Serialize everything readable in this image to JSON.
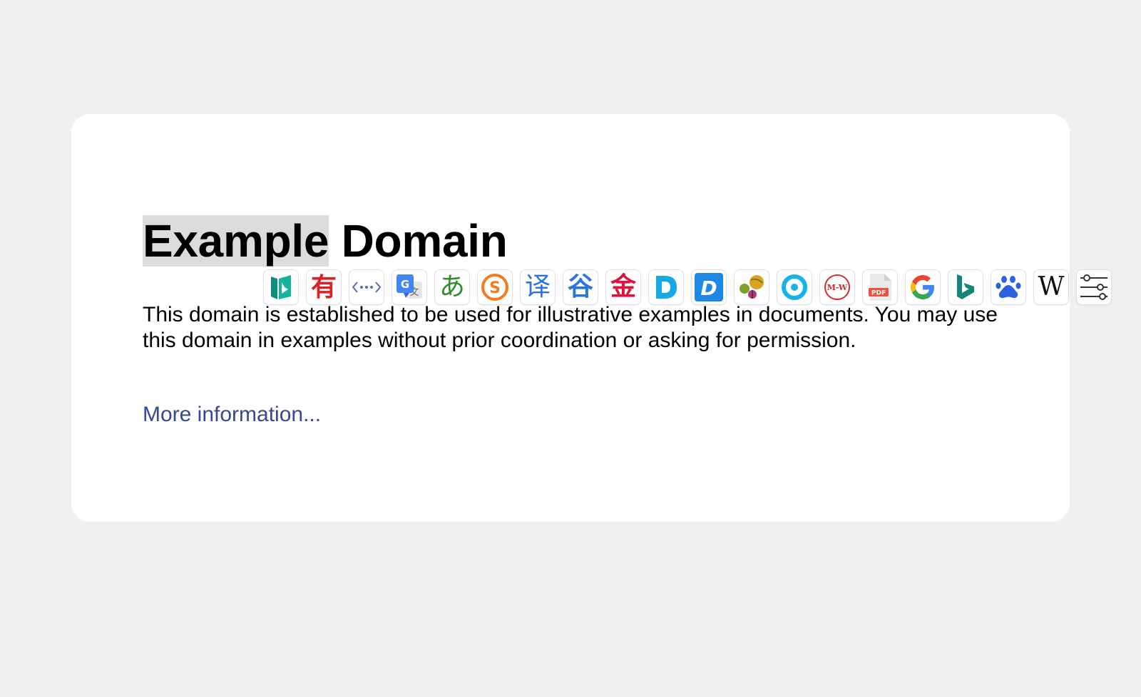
{
  "page": {
    "title_selected": "Example",
    "title_rest": " Domain",
    "paragraph": "This domain is established to be used for illustrative examples in documents. You may use this domain in examples without prior coordination or asking for permission.",
    "link_text": "More information..."
  },
  "toolbar": {
    "items": [
      {
        "name": "bing-dictionary",
        "icon": "bing-dict-icon",
        "color": "#0f9d8a"
      },
      {
        "name": "youdao",
        "glyph": "有",
        "icon": "youdao-icon",
        "color": "#d9232a"
      },
      {
        "name": "code-view",
        "icon": "code-icon",
        "color": "#4a5bb5"
      },
      {
        "name": "google-translate",
        "icon": "google-translate-icon",
        "color": "#4285f4"
      },
      {
        "name": "japanese",
        "glyph": "あ",
        "icon": "hiragana-a-icon",
        "color": "#2e8b2e"
      },
      {
        "name": "sogou",
        "glyph": "S",
        "icon": "sogou-icon",
        "color": "#f47b20"
      },
      {
        "name": "caiyun",
        "glyph": "译",
        "icon": "yi-translate-icon",
        "color": "#2b74d9"
      },
      {
        "name": "guge",
        "glyph": "谷",
        "icon": "gu-icon",
        "color": "#2b74d9"
      },
      {
        "name": "jinshan",
        "glyph": "金",
        "icon": "jin-icon",
        "color": "#e0123d"
      },
      {
        "name": "deepl-outline",
        "glyph": "D",
        "icon": "d-outline-icon",
        "color": "#17a8e6"
      },
      {
        "name": "deepl-solid",
        "glyph": "D",
        "icon": "d-solid-icon",
        "color": "#1e88e5"
      },
      {
        "name": "balls",
        "icon": "balls-icon",
        "color": "#c8a020"
      },
      {
        "name": "circle",
        "icon": "ring-icon",
        "color": "#16b4e6"
      },
      {
        "name": "merriam-webster",
        "glyph": "M-W",
        "icon": "merriam-webster-icon",
        "color": "#d22b2b"
      },
      {
        "name": "pdf",
        "glyph": "PDF",
        "icon": "pdf-icon",
        "color": "#e8533f"
      },
      {
        "name": "google",
        "icon": "google-icon",
        "color": "#4285f4"
      },
      {
        "name": "bing",
        "icon": "bing-icon",
        "color": "#15857a"
      },
      {
        "name": "baidu",
        "icon": "paw-icon",
        "color": "#2b62de"
      },
      {
        "name": "wikipedia",
        "glyph": "W",
        "icon": "wikipedia-icon",
        "color": "#111111"
      },
      {
        "name": "settings",
        "icon": "sliders-icon",
        "color": "#333333"
      }
    ]
  }
}
